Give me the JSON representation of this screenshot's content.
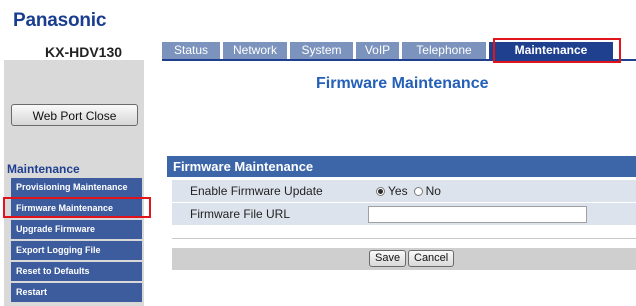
{
  "brand": {
    "logo": "Panasonic",
    "model": "KX-HDV130"
  },
  "tabs": [
    {
      "label": "Status",
      "active": false
    },
    {
      "label": "Network",
      "active": false
    },
    {
      "label": "System",
      "active": false
    },
    {
      "label": "VoIP",
      "active": false
    },
    {
      "label": "Telephone",
      "active": false
    },
    {
      "label": "Maintenance",
      "active": true
    }
  ],
  "sidebar": {
    "web_port_close": "Web Port Close",
    "heading": "Maintenance",
    "items": [
      {
        "label": "Provisioning Maintenance"
      },
      {
        "label": "Firmware Maintenance",
        "selected": true
      },
      {
        "label": "Upgrade Firmware"
      },
      {
        "label": "Export Logging File"
      },
      {
        "label": "Reset to Defaults"
      },
      {
        "label": "Restart"
      }
    ]
  },
  "main": {
    "title": "Firmware Maintenance",
    "section_title": "Firmware Maintenance",
    "enable_update": {
      "label": "Enable Firmware Update",
      "yes": "Yes",
      "no": "No",
      "selected": "Yes"
    },
    "file_url": {
      "label": "Firmware File URL",
      "value": ""
    },
    "save": "Save",
    "cancel": "Cancel"
  },
  "colors": {
    "tab_inactive": "#7b93bd",
    "tab_active": "#1f3f8f",
    "sidebar_item": "#3c5c9e",
    "section_bar": "#3c66a8",
    "title_blue": "#2460b8",
    "highlight_red": "#e1141b"
  }
}
